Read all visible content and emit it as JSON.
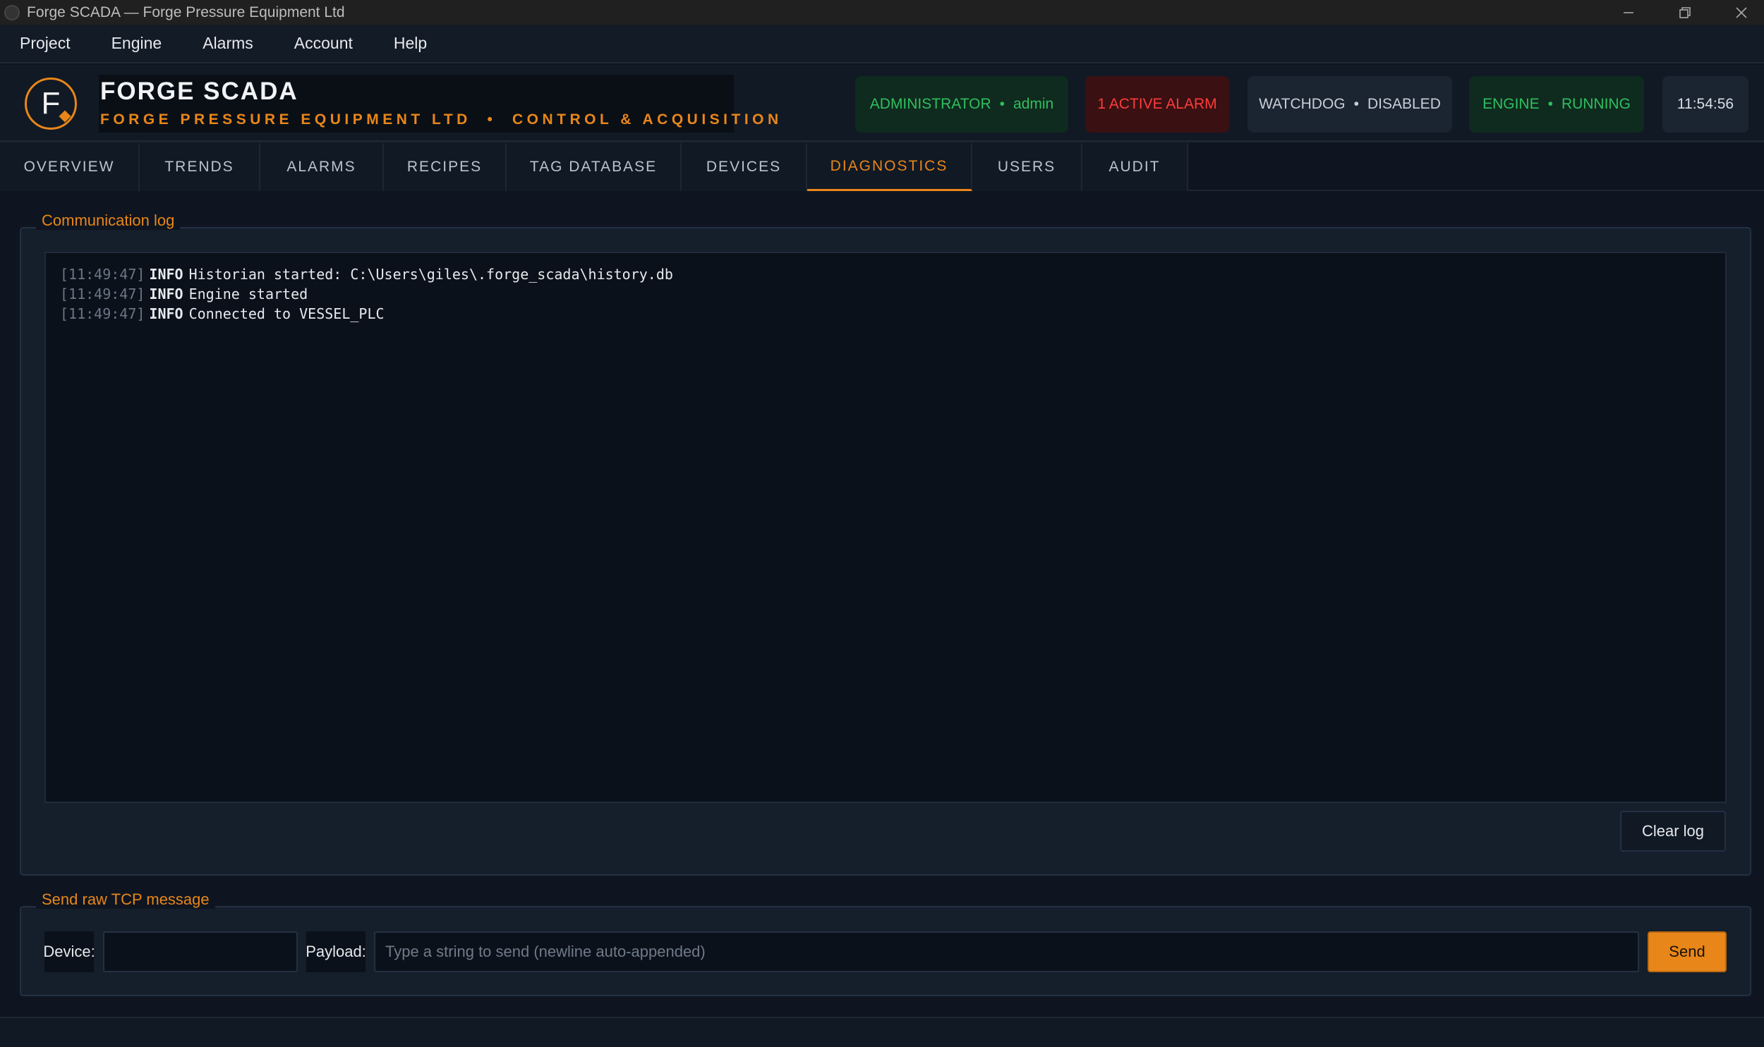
{
  "window": {
    "title": "Forge SCADA — Forge Pressure Equipment Ltd"
  },
  "menu": [
    "Project",
    "Engine",
    "Alarms",
    "Account",
    "Help"
  ],
  "header": {
    "logo_letter": "F",
    "brand_title": "FORGE SCADA",
    "brand_subtitle": "FORGE PRESSURE EQUIPMENT LTD  •  CONTROL & ACQUISITION",
    "role": "ADMINISTRATOR",
    "user": "admin",
    "alarm_status": "1 ACTIVE ALARM",
    "watchdog_label": "WATCHDOG",
    "watchdog_state": "DISABLED",
    "engine_label": "ENGINE",
    "engine_state": "RUNNING",
    "clock": "11:54:56",
    "dot": "•"
  },
  "tabs": [
    {
      "label": "OVERVIEW"
    },
    {
      "label": "TRENDS"
    },
    {
      "label": "ALARMS"
    },
    {
      "label": "RECIPES"
    },
    {
      "label": "TAG DATABASE"
    },
    {
      "label": "DEVICES"
    },
    {
      "label": "DIAGNOSTICS",
      "active": true
    },
    {
      "label": "USERS"
    },
    {
      "label": "AUDIT"
    }
  ],
  "comm_log": {
    "title": "Communication log",
    "entries": [
      {
        "time": "[11:49:47]",
        "level": "INFO",
        "message": "Historian started: C:\\Users\\giles\\.forge_scada\\history.db"
      },
      {
        "time": "[11:49:47]",
        "level": "INFO",
        "message": "Engine started"
      },
      {
        "time": "[11:49:47]",
        "level": "INFO",
        "message": "Connected to VESSEL_PLC"
      }
    ],
    "clear_button": "Clear log"
  },
  "tcp": {
    "title": "Send raw TCP message",
    "device_label": "Device:",
    "device_value": "",
    "payload_label": "Payload:",
    "payload_placeholder": "Type a string to send (newline auto-appended)",
    "send_button": "Send"
  },
  "colors": {
    "accent": "#e8861a",
    "ok": "#2fbf5f",
    "alarm": "#ff3b3b",
    "background": "#0e1520"
  }
}
